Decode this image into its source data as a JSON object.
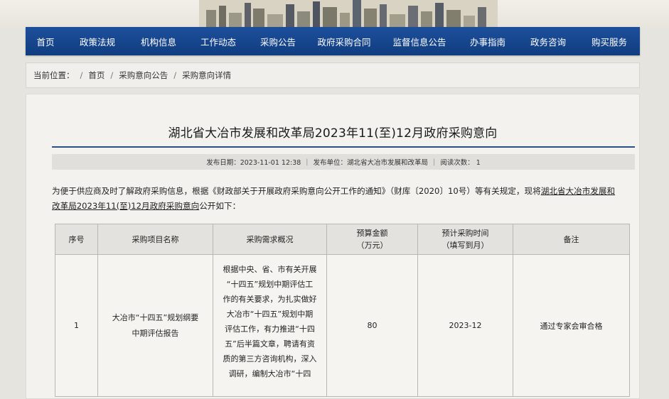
{
  "nav": {
    "items": [
      "首页",
      "政策法规",
      "机构信息",
      "工作动态",
      "采购公告",
      "政府采购合同",
      "监督信息公告",
      "办事指南",
      "政务咨询",
      "购买服务"
    ]
  },
  "breadcrumb": {
    "label": "当前位置：",
    "items": [
      "首页",
      "采购意向公告",
      "采购意向详情"
    ],
    "separator": "/"
  },
  "article": {
    "title": "湖北省大冶市发展和改革局2023年11(至)12月政府采购意向",
    "meta": {
      "date": "发布日期：2023-11-01 12:38",
      "unit": "发布单位：湖北省大冶市发展和改革局",
      "views": "阅读次数： 1",
      "separator": "|"
    },
    "intro_plain": "为便于供应商及时了解政府采购信息，根据《财政部关于开展政府采购意向公开工作的通知》（财库〔2020〕10号）等有关规定，现将",
    "intro_underlined": "湖北省大冶市发展和",
    "intro_line2_underlined": "改革局2023年11(至)12月政府采购意向",
    "intro_line2_rest": "公开如下："
  },
  "table": {
    "headers": {
      "seq": "序号",
      "name": "采购项目名称",
      "desc": "采购需求概况",
      "budget_l1": "预算金额",
      "budget_l2": "（万元）",
      "time_l1": "预计采购时间",
      "time_l2": "（填写到月）",
      "note": "备注"
    },
    "rows": [
      {
        "seq": "1",
        "name_l1": "大冶市“十四五”规划纲要",
        "name_l2": "中期评估报告",
        "desc_lines": [
          "根据中央、省、市有关开展",
          "“十四五”规划中期评估工",
          "作的有关要求，为扎实做好",
          "大冶市“十四五”规划中期",
          "评估工作，有力推进“十四",
          "五”后半篇文章，聘请有资",
          "质的第三方咨询机构，深入",
          "调研，编制大冶市“十四"
        ],
        "budget": "80",
        "time": "2023-12",
        "note": "通过专家会审合格"
      }
    ]
  },
  "colors": {
    "nav_bg": "#1a4a95",
    "title_rule": "#2c4f86"
  }
}
